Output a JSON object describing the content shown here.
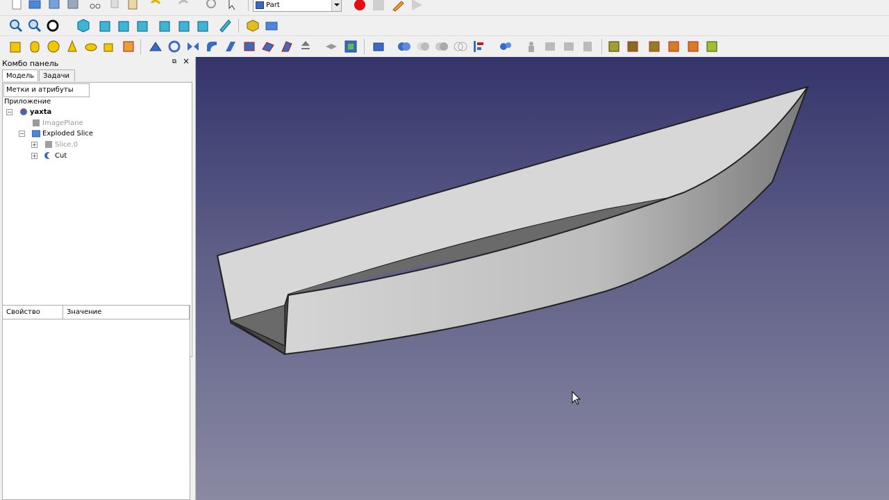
{
  "app": {
    "workbench": "Part"
  },
  "combo_panel": {
    "title": "Комбо панель",
    "tabs": [
      "Модель",
      "Задачи"
    ],
    "tree_header": "Метки и атрибуты",
    "tree_root": "Приложение",
    "tree_items": [
      {
        "label": "yaxta",
        "bold": true,
        "disabled": false
      },
      {
        "label": "ImagePlane",
        "bold": false,
        "disabled": true
      },
      {
        "label": "Exploded Slice",
        "bold": false,
        "disabled": false
      },
      {
        "label": "Slice.0",
        "bold": false,
        "disabled": true
      },
      {
        "label": "Cut",
        "bold": false,
        "disabled": false
      }
    ],
    "property_columns": [
      "Свойство",
      "Значение"
    ]
  },
  "icons": {
    "toolbar1": [
      "new-file-icon",
      "open-icon",
      "save-icon",
      "save-as-icon",
      "cut-icon",
      "copy-icon",
      "paste-icon",
      "undo-icon",
      "redo-icon",
      "refresh-icon",
      "whats-this-icon",
      "record-macro-icon",
      "stop-macro-icon",
      "edit-macro-icon",
      "run-macro-icon"
    ],
    "toolbar2": [
      "fit-all-icon",
      "fit-selection-icon",
      "draw-style-icon",
      "isometric-view-icon",
      "front-view-icon",
      "top-view-icon",
      "right-view-icon",
      "rear-view-icon",
      "bottom-view-icon",
      "left-view-icon",
      "measure-icon",
      "part-icon",
      "group-icon"
    ],
    "toolbar3": [
      "cube-icon",
      "cylinder-icon",
      "sphere-icon",
      "cone-icon",
      "torus-icon",
      "primitives-icon",
      "shape-builder-icon",
      "extrude-icon",
      "revolve-icon",
      "mirror-icon",
      "fillet-icon",
      "chamfer-icon",
      "make-face-icon",
      "ruled-surface-icon",
      "loft-icon",
      "sweep-icon",
      "section-icon",
      "cross-sections-icon",
      "offset-icon",
      "thickness-icon",
      "boolean-icon",
      "cut-icon",
      "fuse-icon",
      "common-icon",
      "join-icon",
      "split-icon",
      "compound-icon",
      "check-geometry-icon",
      "defeaturing-icon",
      "view-zoom-icon",
      "view-box-icon",
      "view-zoom-fit-icon",
      "view-rotate-icon",
      "view-rotate-fit-icon",
      "view-select-icon"
    ]
  },
  "colors": {
    "viewport_top": "#34346c",
    "viewport_bottom": "#8a8aa3",
    "record": "#e01010",
    "hull_light": "#d6d6d6",
    "hull_dark": "#5f5f5f"
  }
}
